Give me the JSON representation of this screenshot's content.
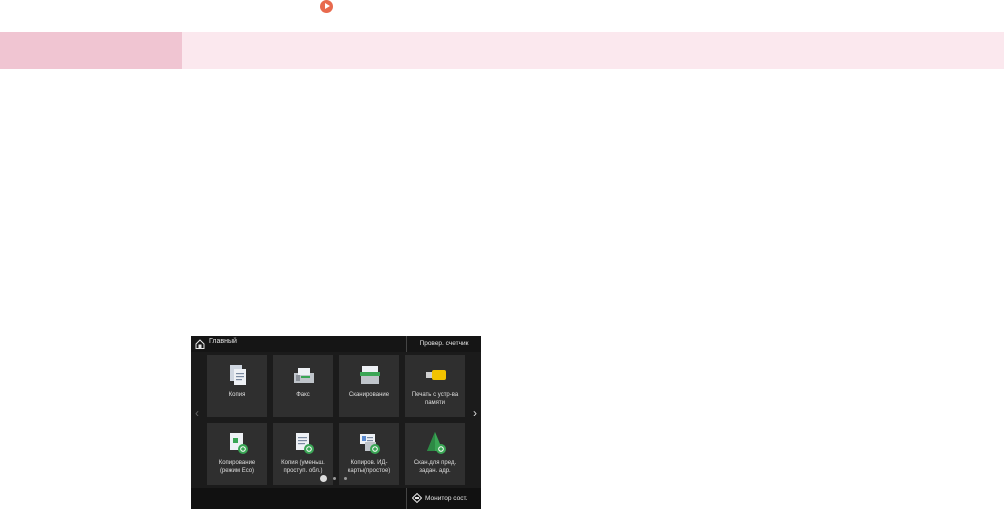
{
  "screen": {
    "title": "Главный",
    "counter_button": "Провер. счетчик",
    "tiles": [
      {
        "label": "Копия",
        "icon": "copy-icon"
      },
      {
        "label": "Факс",
        "icon": "fax-icon"
      },
      {
        "label": "Сканирование",
        "icon": "scan-icon"
      },
      {
        "label": "Печать с устр-ва памяти",
        "icon": "usb-memory-icon"
      },
      {
        "label": "Копирование (режим Eco)",
        "icon": "eco-copy-icon"
      },
      {
        "label": "Копия (уменьш. проступ. обл.)",
        "icon": "reduced-copy-icon"
      },
      {
        "label": "Копиров. ИД-карты(простое)",
        "icon": "id-card-copy-icon"
      },
      {
        "label": "Скан.для пред. задан. адр.",
        "icon": "scan-preset-icon"
      }
    ],
    "page_indicator": {
      "pages": 3,
      "current": 1
    },
    "status_monitor_button": "Монитор сост."
  },
  "colors": {
    "play_icon": "#e86a4e",
    "band_left": "#f0c5d2",
    "band_right": "#fbe8ee",
    "screen_bg": "#1b1b1b",
    "tile_bg": "#2f2f2f",
    "accent_green": "#3aa655",
    "accent_yellow": "#f2c200"
  }
}
